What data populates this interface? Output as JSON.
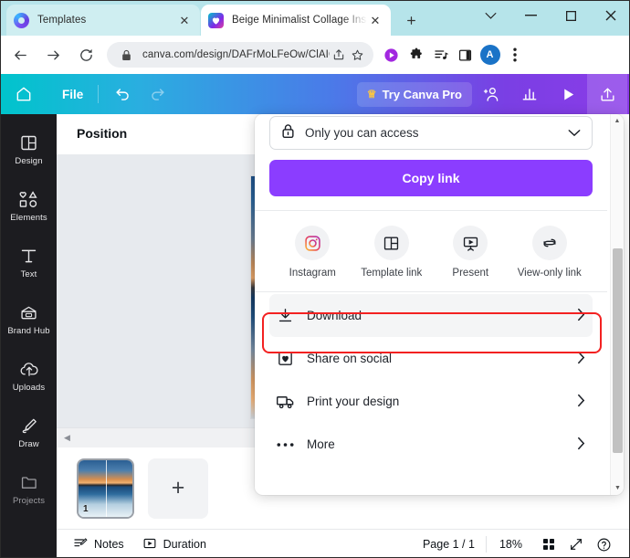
{
  "browser": {
    "tabs": [
      {
        "title": "Templates",
        "favicon": "chrome-icon",
        "active": false
      },
      {
        "title": "Beige Minimalist Collage Ins",
        "favicon": "canva-icon",
        "active": true
      }
    ],
    "new_tab_label": "+",
    "window_controls": {
      "chevron": "∨",
      "minimize": "–",
      "maximize": "□",
      "close": "✕"
    },
    "nav": {
      "back": "back-icon",
      "forward": "forward-icon",
      "reload": "reload-icon"
    },
    "omnibox": {
      "url": "canva.com/design/DAFrMoLFeOw/ClAICsVyK...",
      "lock": "lock-icon",
      "share": "share-icon",
      "bookmark": "star-icon"
    },
    "extensions": [
      "media-play-icon",
      "puzzle-icon",
      "reading-list-icon",
      "side-panel-icon"
    ],
    "profile_initial": "A",
    "menu": "kebab-menu-icon"
  },
  "canva_toolbar": {
    "home": "home-icon",
    "file_label": "File",
    "undo": "undo-icon",
    "redo": "redo-icon",
    "try_pro_label": "Try Canva Pro",
    "crown": "crown-icon",
    "collaborate": "add-collaborator-icon",
    "insights": "insights-icon",
    "present": "present-play-icon",
    "share": "share-upload-icon"
  },
  "sidebar": {
    "items": [
      {
        "label": "Design",
        "icon": "design-icon"
      },
      {
        "label": "Elements",
        "icon": "elements-icon"
      },
      {
        "label": "Text",
        "icon": "text-icon"
      },
      {
        "label": "Brand Hub",
        "icon": "brand-hub-icon"
      },
      {
        "label": "Uploads",
        "icon": "uploads-icon"
      },
      {
        "label": "Draw",
        "icon": "draw-icon"
      },
      {
        "label": "Projects",
        "icon": "projects-icon"
      }
    ]
  },
  "position_panel": {
    "title": "Position"
  },
  "pages": {
    "collapse": "collapse-arrow-icon",
    "thumbnail_number": "1",
    "add_page_label": "+"
  },
  "share_panel": {
    "access": {
      "label": "Only you can access",
      "lock": "lock-icon",
      "chevron": "chevron-down-icon"
    },
    "copy_link_label": "Copy link",
    "quick_actions": [
      {
        "label": "Instagram",
        "icon": "instagram-icon"
      },
      {
        "label": "Template link",
        "icon": "template-link-icon"
      },
      {
        "label": "Present",
        "icon": "present-icon"
      },
      {
        "label": "View-only link",
        "icon": "view-only-link-icon"
      }
    ],
    "menu_items": [
      {
        "label": "Download",
        "icon": "download-icon",
        "highlighted": true
      },
      {
        "label": "Share on social",
        "icon": "heart-box-icon",
        "highlighted": false
      },
      {
        "label": "Print your design",
        "icon": "truck-icon",
        "highlighted": false
      },
      {
        "label": "More",
        "icon": "ellipsis-icon",
        "highlighted": false
      }
    ],
    "chevron": "›",
    "highlight_color": "#f32121"
  },
  "bottom_bar": {
    "notes_label": "Notes",
    "notes_icon": "notes-icon",
    "duration_label": "Duration",
    "duration_icon": "duration-icon",
    "page_indicator": "Page 1 / 1",
    "zoom_level": "18%",
    "grid_icon": "grid-view-icon",
    "fullscreen_icon": "fullscreen-icon",
    "help_icon": "help-icon"
  },
  "colors": {
    "canva_purple": "#8b3dff",
    "canva_teal": "#00c4cc",
    "rail_dark": "#1c1c20",
    "tabstrip": "#b6e4ea",
    "highlight_red": "#f32121"
  }
}
